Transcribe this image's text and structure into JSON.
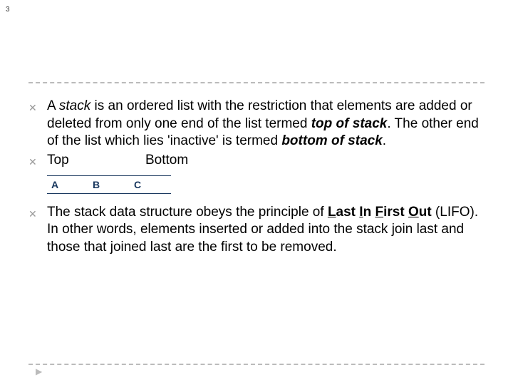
{
  "slide_number": "3",
  "para1": {
    "prefix": "A ",
    "stack": "stack",
    "mid1": " is an ordered list with the restriction that elements are added or deleted from only one end of the list termed ",
    "top_of_stack": "top of stack",
    "mid2": ". The other end of the list which lies 'inactive' is termed ",
    "bottom_of_stack": "bottom of stack",
    "suffix": "."
  },
  "top_bottom": {
    "top": "Top",
    "bottom": "Bottom"
  },
  "cells": {
    "a": "A",
    "b": "B",
    "c": "C"
  },
  "para2": {
    "t1": "The stack data structure  obeys the principle of ",
    "L": "L",
    "ast": "ast ",
    "I": "I",
    "n": "n ",
    "F": "F",
    "irst": "irst ",
    "O": "O",
    "ut": "ut",
    "acr": " (LIFO). In other words, elements inserted or added into the stack join last and those that joined last are the first to be removed."
  },
  "nav_cue": "▶"
}
